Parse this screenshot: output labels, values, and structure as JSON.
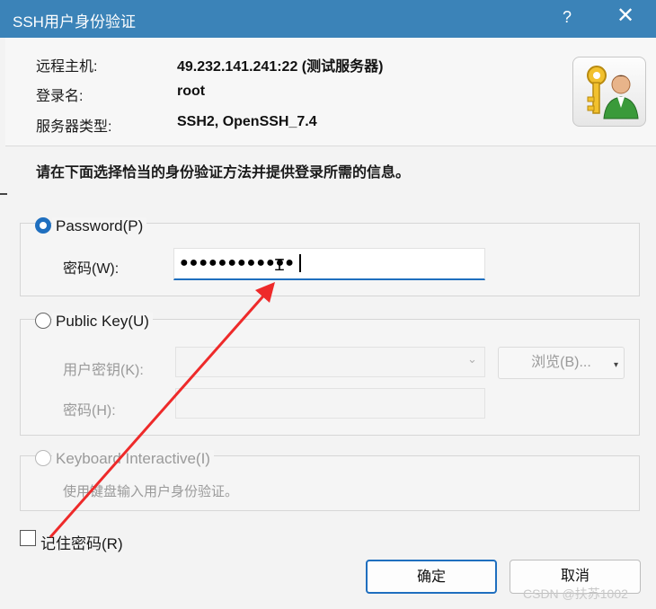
{
  "window": {
    "title": "SSH用户身份验证",
    "help": "?",
    "close": "✕"
  },
  "info": {
    "host_label": "远程主机:",
    "host_value": "49.232.141.241:22 (测试服务器)",
    "login_label": "登录名:",
    "login_value": "root",
    "server_type_label": "服务器类型:",
    "server_type_value": "SSH2, OpenSSH_7.4"
  },
  "instruction": "请在下面选择恰当的身份验证方法并提供登录所需的信息。",
  "password_group": {
    "radio_label": "Password(P)",
    "selected": true,
    "field_label": "密码(W):",
    "field_value": "●●●●●●●●●●●●"
  },
  "publickey_group": {
    "radio_label": "Public Key(U)",
    "selected": false,
    "key_label": "用户密钥(K):",
    "key_value": "",
    "browse_label": "浏览(B)...",
    "browse_arrow": "▾",
    "passphrase_label": "密码(H):",
    "passphrase_value": ""
  },
  "keyboard_group": {
    "radio_label": "Keyboard Interactive(I)",
    "selected": false,
    "description": "使用键盘输入用户身份验证。"
  },
  "remember_label": "记住密码(R)",
  "remember_checked": false,
  "buttons": {
    "ok": "确定",
    "cancel": "取消"
  },
  "watermark": "CSDN @扶苏1002",
  "colors": {
    "titlebar": "#3b83b8",
    "accent": "#1f6fbf",
    "annotation_arrow": "#ee2a2a"
  },
  "icons": {
    "identity": "key-user-icon",
    "dropdown": "chevron-down-icon"
  }
}
